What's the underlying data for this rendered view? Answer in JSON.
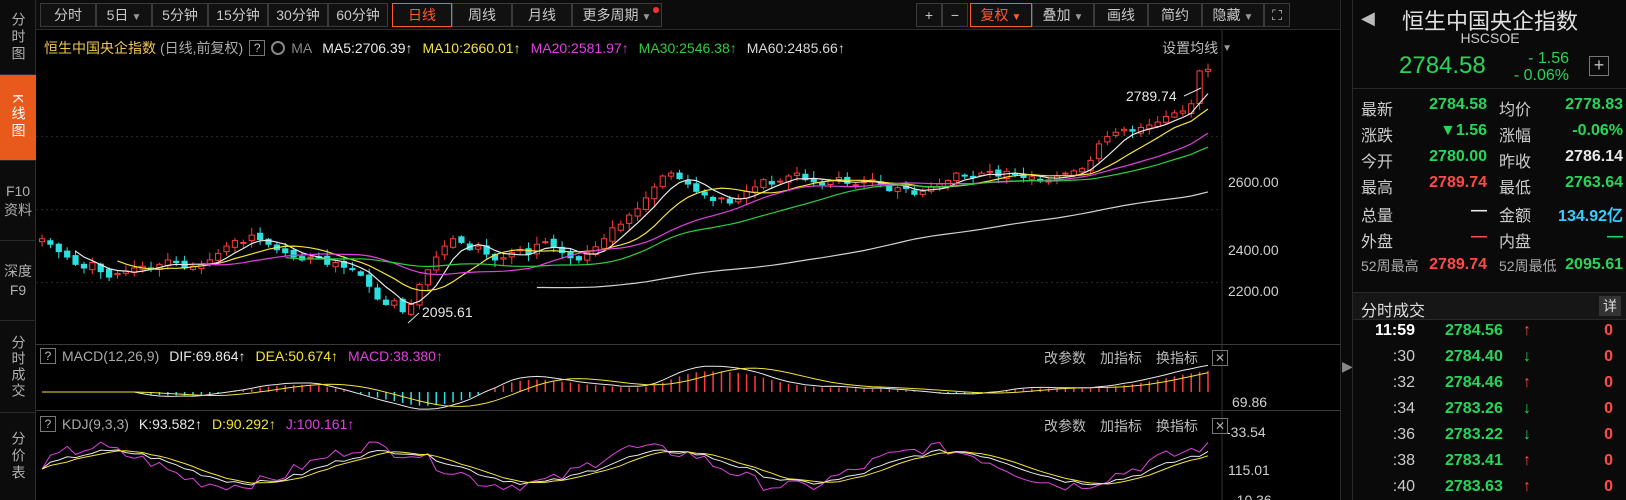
{
  "left_tabs": [
    {
      "label": "分时图",
      "name": "tab-fenshi"
    },
    {
      "label": "K线图",
      "name": "tab-kline"
    },
    {
      "label": "F10资料",
      "name": "tab-f10"
    },
    {
      "label": "深度F9",
      "name": "tab-depth"
    },
    {
      "label": "分时成交",
      "name": "tab-fenshi-trades"
    },
    {
      "label": "分价表",
      "name": "tab-price-table"
    }
  ],
  "toolbar": {
    "periods": [
      "分时",
      "5日",
      "5分钟",
      "15分钟",
      "30分钟",
      "60分钟",
      "日线",
      "周线",
      "月线",
      "更多周期"
    ],
    "active_period": "日线",
    "plus": "+",
    "minus": "−",
    "fuquan": "复权",
    "overlay": "叠加",
    "draw": "画线",
    "simple": "简约",
    "hide": "隐藏",
    "fullscreen_icon": "fullscreen-icon"
  },
  "main": {
    "title": "恒生中国央企指数",
    "subtitle": "(日线,前复权)",
    "ma_label": "MA",
    "ma": [
      {
        "label": "MA5:2706.39",
        "color": "#e8e8e8"
      },
      {
        "label": "MA10:2660.01",
        "color": "#f5e23a"
      },
      {
        "label": "MA20:2581.97",
        "color": "#e040e0"
      },
      {
        "label": "MA30:2546.38",
        "color": "#2ecc40"
      },
      {
        "label": "MA60:2485.66",
        "color": "#d8d8d8"
      }
    ],
    "settings": "设置均线",
    "high_label": "2789.74",
    "low_label": "2095.61",
    "y_ticks": [
      "2600.00",
      "2400.00",
      "2200.00"
    ]
  },
  "macd": {
    "name": "MACD(12,26,9)",
    "dif": "DIF:69.864",
    "dea": "DEA:50.674",
    "macd": "MACD:38.380",
    "y_ticks": [
      "69.86",
      "-33.54"
    ],
    "links": [
      "改参数",
      "加指标",
      "换指标"
    ]
  },
  "kdj": {
    "name": "KDJ(9,3,3)",
    "k": "K:93.582",
    "d": "D:90.292",
    "j": "J:100.161",
    "y_ticks": [
      "115.01",
      "-10.36"
    ],
    "links": [
      "改参数",
      "加指标",
      "换指标"
    ]
  },
  "chart_data": {
    "type": "candlestick",
    "title": "恒生中国央企指数",
    "high": 2789.74,
    "low": 2095.61,
    "y_ticks": [
      2600,
      2400,
      2200
    ],
    "ma": {
      "MA5": 2706.39,
      "MA10": 2660.01,
      "MA20": 2581.97,
      "MA30": 2546.38,
      "MA60": 2485.66
    },
    "closes": [
      2320,
      2305,
      2285,
      2270,
      2250,
      2240,
      2255,
      2230,
      2215,
      2225,
      2232,
      2240,
      2245,
      2238,
      2250,
      2262,
      2255,
      2240,
      2245,
      2250,
      2262,
      2280,
      2300,
      2315,
      2310,
      2330,
      2318,
      2305,
      2290,
      2282,
      2270,
      2262,
      2270,
      2268,
      2250,
      2255,
      2242,
      2236,
      2220,
      2190,
      2155,
      2140,
      2150,
      2120,
      2140,
      2195,
      2235,
      2270,
      2300,
      2320,
      2310,
      2290,
      2300,
      2278,
      2262,
      2268,
      2282,
      2290,
      2278,
      2305,
      2312,
      2298,
      2282,
      2268,
      2262,
      2282,
      2298,
      2320,
      2350,
      2360,
      2385,
      2402,
      2432,
      2462,
      2492,
      2500,
      2485,
      2470,
      2450,
      2440,
      2425,
      2432,
      2418,
      2430,
      2450,
      2462,
      2482,
      2470,
      2478,
      2492,
      2500,
      2482,
      2476,
      2468,
      2478,
      2488,
      2472,
      2468,
      2476,
      2482,
      2470,
      2452,
      2460,
      2458,
      2442,
      2450,
      2462,
      2470,
      2480,
      2500,
      2492,
      2488,
      2500,
      2505,
      2492,
      2505,
      2498,
      2488,
      2490,
      2478,
      2482,
      2492,
      2500,
      2506,
      2512,
      2535,
      2580,
      2600,
      2612,
      2620,
      2615,
      2625,
      2632,
      2640,
      2655,
      2665,
      2670,
      2690,
      2780,
      2784.58
    ]
  }
}
